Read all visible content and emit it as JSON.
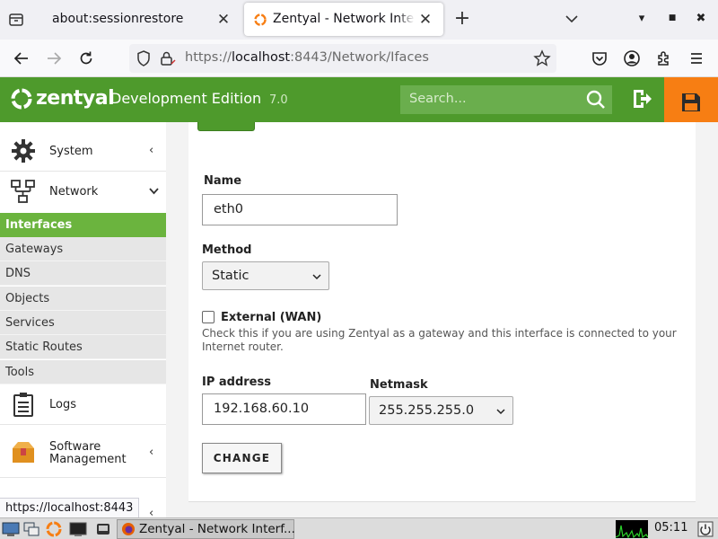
{
  "browser": {
    "tabs": [
      {
        "title": "about:sessionrestore",
        "active": false
      },
      {
        "title": "Zentyal - Network Interfaces",
        "active": true
      }
    ],
    "url": {
      "prefix": "https://",
      "host": "localhost",
      "rest": ":8443/Network/Ifaces"
    },
    "status_url": "https://localhost:8443"
  },
  "header": {
    "brand": "zentyal",
    "edition": "Development Edition",
    "version": "7.0",
    "search_placeholder": "Search..."
  },
  "sidebar": {
    "main_items": [
      {
        "label": "System",
        "icon": "gear-icon",
        "chevron": "‹"
      },
      {
        "label": "Network",
        "icon": "network-icon",
        "chevron": "⌄"
      },
      {
        "label": "Logs",
        "icon": "clipboard-icon"
      },
      {
        "label": "Software Management",
        "label_line1": "Software",
        "label_line2": "Management",
        "icon": "package-icon",
        "chevron": "‹"
      }
    ],
    "active_subitem": "Interfaces",
    "subitems": [
      "Gateways",
      "DNS",
      "Objects",
      "Services",
      "Static Routes",
      "Tools"
    ]
  },
  "form": {
    "name_label": "Name",
    "name_value": "eth0",
    "method_label": "Method",
    "method_value": "Static",
    "external_label": "External (WAN)",
    "external_checked": false,
    "external_help": "Check this if you are using Zentyal as a gateway and this interface is connected to your Internet router.",
    "external_help_line1": "Check this if you are using Zentyal as a gateway and this interface is connected to your",
    "external_help_line2": "Internet router.",
    "ip_label": "IP address",
    "ip_value": "192.168.60.10",
    "netmask_label": "Netmask",
    "netmask_value": "255.255.255.0",
    "change_button": "CHANGE"
  },
  "taskbar": {
    "task_title": "Zentyal - Network Interf...",
    "clock": "05:11"
  },
  "colors": {
    "zentyal_green": "#4e9a2c",
    "active_item_green": "#6bb43e",
    "save_orange": "#f77e13"
  }
}
